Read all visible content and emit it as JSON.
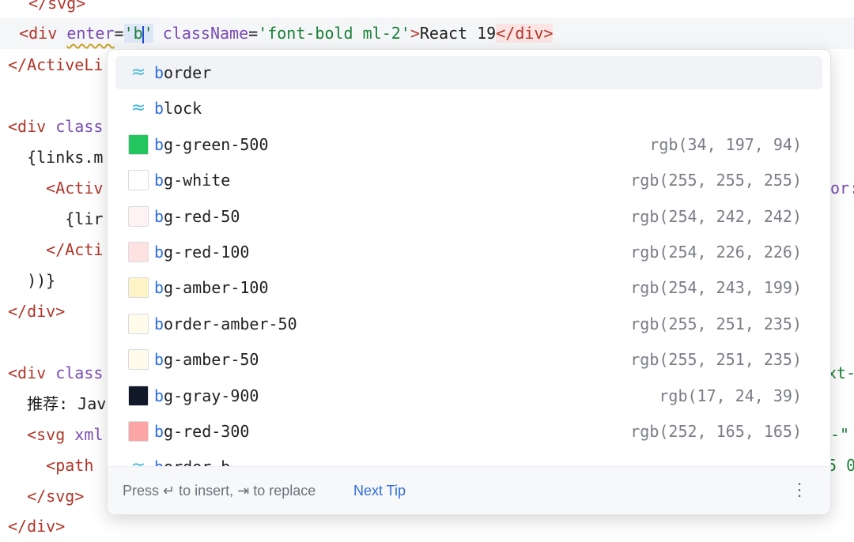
{
  "code": {
    "line0": {
      "tag_open": "</",
      "tag_name": "svg",
      "tag_close": ">"
    },
    "line1": {
      "indent": "  ",
      "lt": "<",
      "tag": "div",
      "attr1_name": "enter",
      "attr1_eq": "=",
      "attr1_value_a": "'b",
      "attr1_value_b": "'",
      "attr2_name": "className",
      "attr2_eq": "=",
      "attr2_value": "'font-bold ml-2'",
      "gt": ">",
      "text": "React 19",
      "close_lt": "</",
      "close_tag": "div",
      "close_gt": ">"
    },
    "line2": {
      "lt": "</",
      "tag": "ActiveLi"
    },
    "line3": {
      "lt": "<",
      "tag": "div",
      "rest": " class"
    },
    "line4": {
      "text": "  {links.m"
    },
    "line5": {
      "indent": "    ",
      "lt": "<",
      "tag": "Activ",
      "right": "or:"
    },
    "line6": {
      "text": "      {lir"
    },
    "line7": {
      "indent": "    ",
      "lt": "</",
      "tag": "Acti"
    },
    "line8": {
      "text": "  ))}"
    },
    "line9": {
      "lt": "</",
      "tag": "div",
      "gt": ">"
    },
    "line10": {
      "lt": "<",
      "tag": "div",
      "rest": " class",
      "right": "xt-"
    },
    "line11": {
      "text": "  推荐: Jav"
    },
    "line12": {
      "indent": "  ",
      "lt": "<",
      "tag": "svg",
      "rest": " xml",
      "right": "-\""
    },
    "line13": {
      "indent": "    ",
      "lt": "<",
      "tag": "path",
      "right": "5 0"
    },
    "line14": {
      "indent": "  ",
      "lt": "</",
      "tag": "svg",
      "gt": ">"
    },
    "line15": {
      "lt": "</",
      "tag": "div",
      "gt": ">"
    }
  },
  "completion": {
    "items": [
      {
        "icon": "tailwind-icon",
        "match": "b",
        "rest": "order",
        "value": "",
        "color": ""
      },
      {
        "icon": "tailwind-icon",
        "match": "b",
        "rest": "lock",
        "value": "",
        "color": ""
      },
      {
        "icon": "color-swatch-icon",
        "match": "b",
        "rest": "g-green-500",
        "value": "rgb(34, 197, 94)",
        "color": "#22c55e"
      },
      {
        "icon": "color-swatch-icon",
        "match": "b",
        "rest": "g-white",
        "value": "rgb(255, 255, 255)",
        "color": "#ffffff"
      },
      {
        "icon": "color-swatch-icon",
        "match": "b",
        "rest": "g-red-50",
        "value": "rgb(254, 242, 242)",
        "color": "#fef2f2"
      },
      {
        "icon": "color-swatch-icon",
        "match": "b",
        "rest": "g-red-100",
        "value": "rgb(254, 226, 226)",
        "color": "#fee2e2"
      },
      {
        "icon": "color-swatch-icon",
        "match": "b",
        "rest": "g-amber-100",
        "value": "rgb(254, 243, 199)",
        "color": "#fef3c7"
      },
      {
        "icon": "color-swatch-icon",
        "match": "b",
        "rest": "order-amber-50",
        "value": "rgb(255, 251, 235)",
        "color": "#fffbeb"
      },
      {
        "icon": "color-swatch-icon",
        "match": "b",
        "rest": "g-amber-50",
        "value": "rgb(255, 251, 235)",
        "color": "#fffbeb"
      },
      {
        "icon": "color-swatch-icon",
        "match": "b",
        "rest": "g-gray-900",
        "value": "rgb(17, 24, 39)",
        "color": "#111827"
      },
      {
        "icon": "color-swatch-icon",
        "match": "b",
        "rest": "g-red-300",
        "value": "rgb(252, 165, 165)",
        "color": "#fca5a5"
      },
      {
        "icon": "tailwind-icon",
        "match": "b",
        "rest": "order-b",
        "value": "",
        "color": ""
      }
    ],
    "footer": {
      "hint": "Press ↵ to insert, ⇥ to replace",
      "next_tip": "Next Tip",
      "more": "⋮"
    }
  }
}
